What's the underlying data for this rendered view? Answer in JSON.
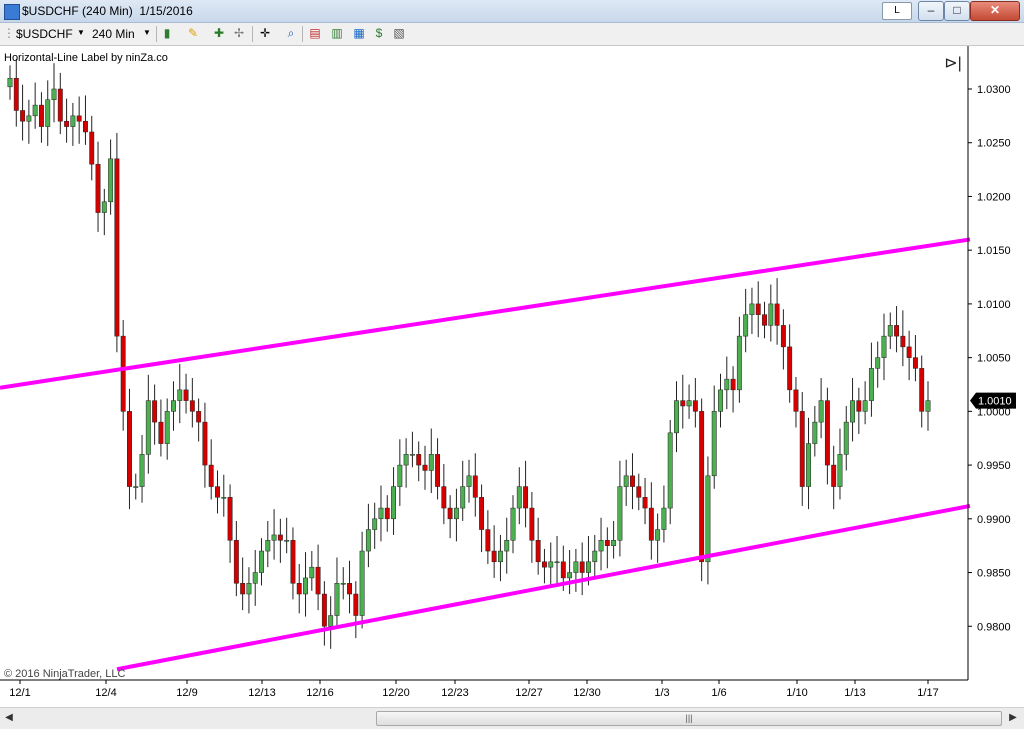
{
  "window": {
    "title": "$USDCHF (240 Min)  1/15/2016",
    "l_button": "L",
    "minimize": "–",
    "maximize": "□",
    "close": "✕"
  },
  "toolbar": {
    "instrument": "$USDCHF",
    "interval": "240 Min",
    "icons": [
      "candlestick-icon",
      "pencil-icon",
      "crosshair-icon",
      "zoom-icon",
      "data-box-icon",
      "chart-properties-icon",
      "strategy-icon",
      "indicators-icon"
    ]
  },
  "indicator_label": "Horizontal-Line Label by ninZa.co",
  "copyright": "© 2016 NinjaTrader, LLC",
  "current_price": "1.0010",
  "chart_data": {
    "type": "candlestick",
    "x_labels": [
      "12/1",
      "12/4",
      "12/9",
      "12/13",
      "12/16",
      "12/20",
      "12/23",
      "12/27",
      "12/30",
      "1/3",
      "1/6",
      "1/10",
      "1/13",
      "1/17"
    ],
    "y_ticks": [
      "1.0300",
      "1.0250",
      "1.0200",
      "1.0150",
      "1.0100",
      "1.0050",
      "1.0000",
      "0.9950",
      "0.9900",
      "0.9850",
      "0.9800"
    ],
    "ylim": [
      0.975,
      1.034
    ],
    "bull_color": "#4caf50",
    "bear_color": "#d40000",
    "channel_color": "#ff00ff",
    "channel_lines": [
      {
        "from": {
          "bar": 0,
          "price": 1.0022
        },
        "to": {
          "bar": 148,
          "price": 1.016
        }
      },
      {
        "from": {
          "bar": 17,
          "price": 0.976
        },
        "to": {
          "bar": 148,
          "price": 0.9912
        }
      }
    ],
    "closes": [
      1.031,
      1.028,
      1.027,
      1.0275,
      1.0285,
      1.0265,
      1.029,
      1.03,
      1.027,
      1.0265,
      1.0275,
      1.027,
      1.026,
      1.023,
      1.0185,
      1.0195,
      1.0235,
      1.007,
      1.0,
      0.993,
      0.993,
      0.996,
      1.001,
      0.999,
      0.997,
      1.0,
      1.001,
      1.002,
      1.001,
      1.0,
      0.999,
      0.995,
      0.993,
      0.992,
      0.992,
      0.988,
      0.984,
      0.983,
      0.984,
      0.985,
      0.987,
      0.988,
      0.9885,
      0.988,
      0.988,
      0.984,
      0.983,
      0.9845,
      0.9855,
      0.983,
      0.98,
      0.981,
      0.984,
      0.984,
      0.983,
      0.981,
      0.987,
      0.989,
      0.99,
      0.991,
      0.99,
      0.993,
      0.995,
      0.996,
      0.996,
      0.995,
      0.9945,
      0.996,
      0.993,
      0.991,
      0.99,
      0.991,
      0.993,
      0.994,
      0.992,
      0.989,
      0.987,
      0.986,
      0.987,
      0.988,
      0.991,
      0.993,
      0.991,
      0.988,
      0.986,
      0.9855,
      0.986,
      0.986,
      0.9845,
      0.985,
      0.986,
      0.985,
      0.986,
      0.987,
      0.988,
      0.9875,
      0.988,
      0.993,
      0.994,
      0.993,
      0.992,
      0.991,
      0.988,
      0.989,
      0.991,
      0.998,
      1.001,
      1.0005,
      1.001,
      1.0,
      0.986,
      0.994,
      1.0,
      1.002,
      1.003,
      1.002,
      1.007,
      1.009,
      1.01,
      1.009,
      1.008,
      1.01,
      1.008,
      1.006,
      1.002,
      1.0,
      0.993,
      0.997,
      0.999,
      1.001,
      0.995,
      0.993,
      0.996,
      0.999,
      1.001,
      1.0,
      1.001,
      1.004,
      1.005,
      1.007,
      1.008,
      1.007,
      1.006,
      1.005,
      1.004,
      1.0,
      1.001
    ]
  }
}
